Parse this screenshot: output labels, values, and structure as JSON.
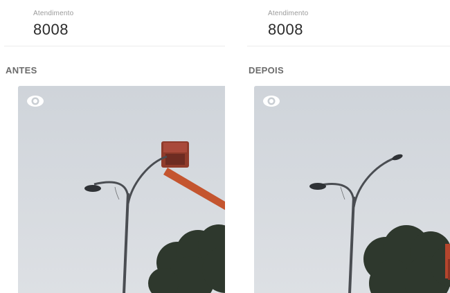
{
  "before": {
    "attendance_label": "Atendimento",
    "attendance_number": "8008",
    "section_title": "ANTES",
    "view_icon": "eye-icon"
  },
  "after": {
    "attendance_label": "Atendimento",
    "attendance_number": "8008",
    "section_title": "DEPOIS",
    "view_icon": "eye-icon"
  },
  "colors": {
    "sky": "#d7dbe0",
    "pole": "#4a4d52",
    "tree": "#2f3a2e",
    "truck_arm": "#c8502e",
    "label": "#9a9a9a",
    "value": "#2b2b2b",
    "section": "#6b6b6b"
  }
}
